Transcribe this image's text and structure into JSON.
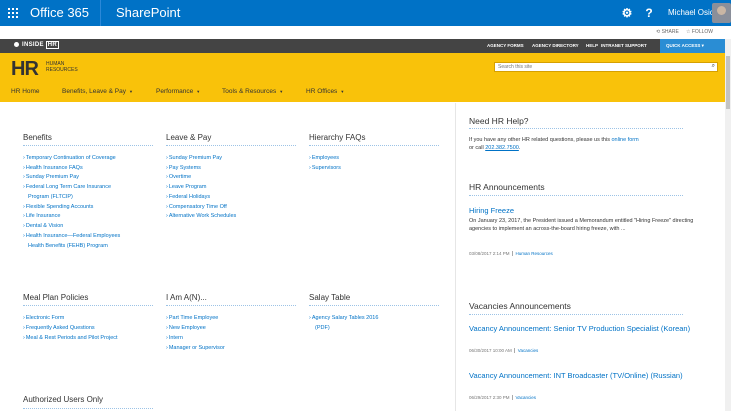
{
  "suitebar": {
    "o365": "Office 365",
    "sharepoint": "SharePoint",
    "settings_icon": "gear-icon",
    "help": "?",
    "user": "Michael Osicki"
  },
  "sharebar": {
    "share": "SHARE",
    "follow": "FOLLOW"
  },
  "topnav": {
    "logo": "INSIDE",
    "items": [
      "AGENCY FORMS",
      "AGENCY DIRECTORY",
      "HELP",
      "INTRANET SUPPORT"
    ],
    "quick_access": "QUICK ACCESS"
  },
  "header": {
    "logo": "HR",
    "logo_sub_1": "HUMAN",
    "logo_sub_2": "RESOURCES",
    "search_placeholder": "Search this site",
    "nav": [
      {
        "label": "HR Home"
      },
      {
        "label": "Benefits, Leave & Pay"
      },
      {
        "label": "Performance"
      },
      {
        "label": "Tools & Resources"
      },
      {
        "label": "HR Offices"
      }
    ]
  },
  "sections": {
    "benefits": {
      "title": "Benefits",
      "items": [
        "Temporary Continuation of Coverage",
        "Health Insurance FAQs",
        "Sunday Premium Pay",
        "Federal Long Term Care Insurance",
        "Program (FLTCIP)",
        "Flexible Spending Accounts",
        "Life Insurance",
        "Dental & Vision",
        "Health Insurance—Federal Employees",
        "Health Benefits (FEHB) Program"
      ]
    },
    "leave": {
      "title": "Leave & Pay",
      "items": [
        "Sunday Premium Pay",
        "Pay Systems",
        "Overtime",
        "Leave Program",
        "Federal Holidays",
        "Compensatory Time Off",
        "Alternative Work Schedules"
      ]
    },
    "hierarchy": {
      "title": "Hierarchy FAQs",
      "items": [
        "Employees",
        "Supervisors"
      ]
    },
    "meal": {
      "title": "Meal Plan Policies",
      "items": [
        "Electronic Form",
        "Frequently Asked Questions",
        "Meal & Rest Periods and Pilot Project"
      ]
    },
    "iam": {
      "title": "I Am A(N)...",
      "items": [
        "Part Time Employee",
        "New Employee",
        "Intern",
        "Manager or Supervisor"
      ]
    },
    "salary": {
      "title": "Salay Table",
      "items": [
        "Agency Salary Tables 2016",
        "(PDF)"
      ]
    },
    "authorized": {
      "title": "Authorized Users Only"
    }
  },
  "sidebar": {
    "help_title": "Need HR Help?",
    "help_text_1": "If you have any other HR related questions, please us this",
    "help_link": "online form",
    "help_text_2": "or call",
    "help_phone": "202.382.7500",
    "help_period": ".",
    "ann_title": "HR Announcements",
    "ann_item_title": "Hiring Freeze",
    "ann_item_text": "On January 23, 2017, the President issued a Memorandum entitled \"Hiring Freeze\" directing agencies to implement an across-the-board hiring freeze, with ...",
    "ann_item_date": "03/08/2017 2:14 PM",
    "ann_item_cat": "Human Resources",
    "vac_title": "Vacancies Announcements",
    "vac1_title": "Vacancy Announcement: Senior TV Production Specialist (Korean)",
    "vac1_date": "06/30/2017 10:00 AM",
    "vac1_cat": "Vacancies",
    "vac2_title": "Vacancy Announcement: INT Broadcaster (TV/Online) (Russian)",
    "vac2_date": "06/29/2017 2:30 PM",
    "vac2_cat": "Vacancies"
  }
}
